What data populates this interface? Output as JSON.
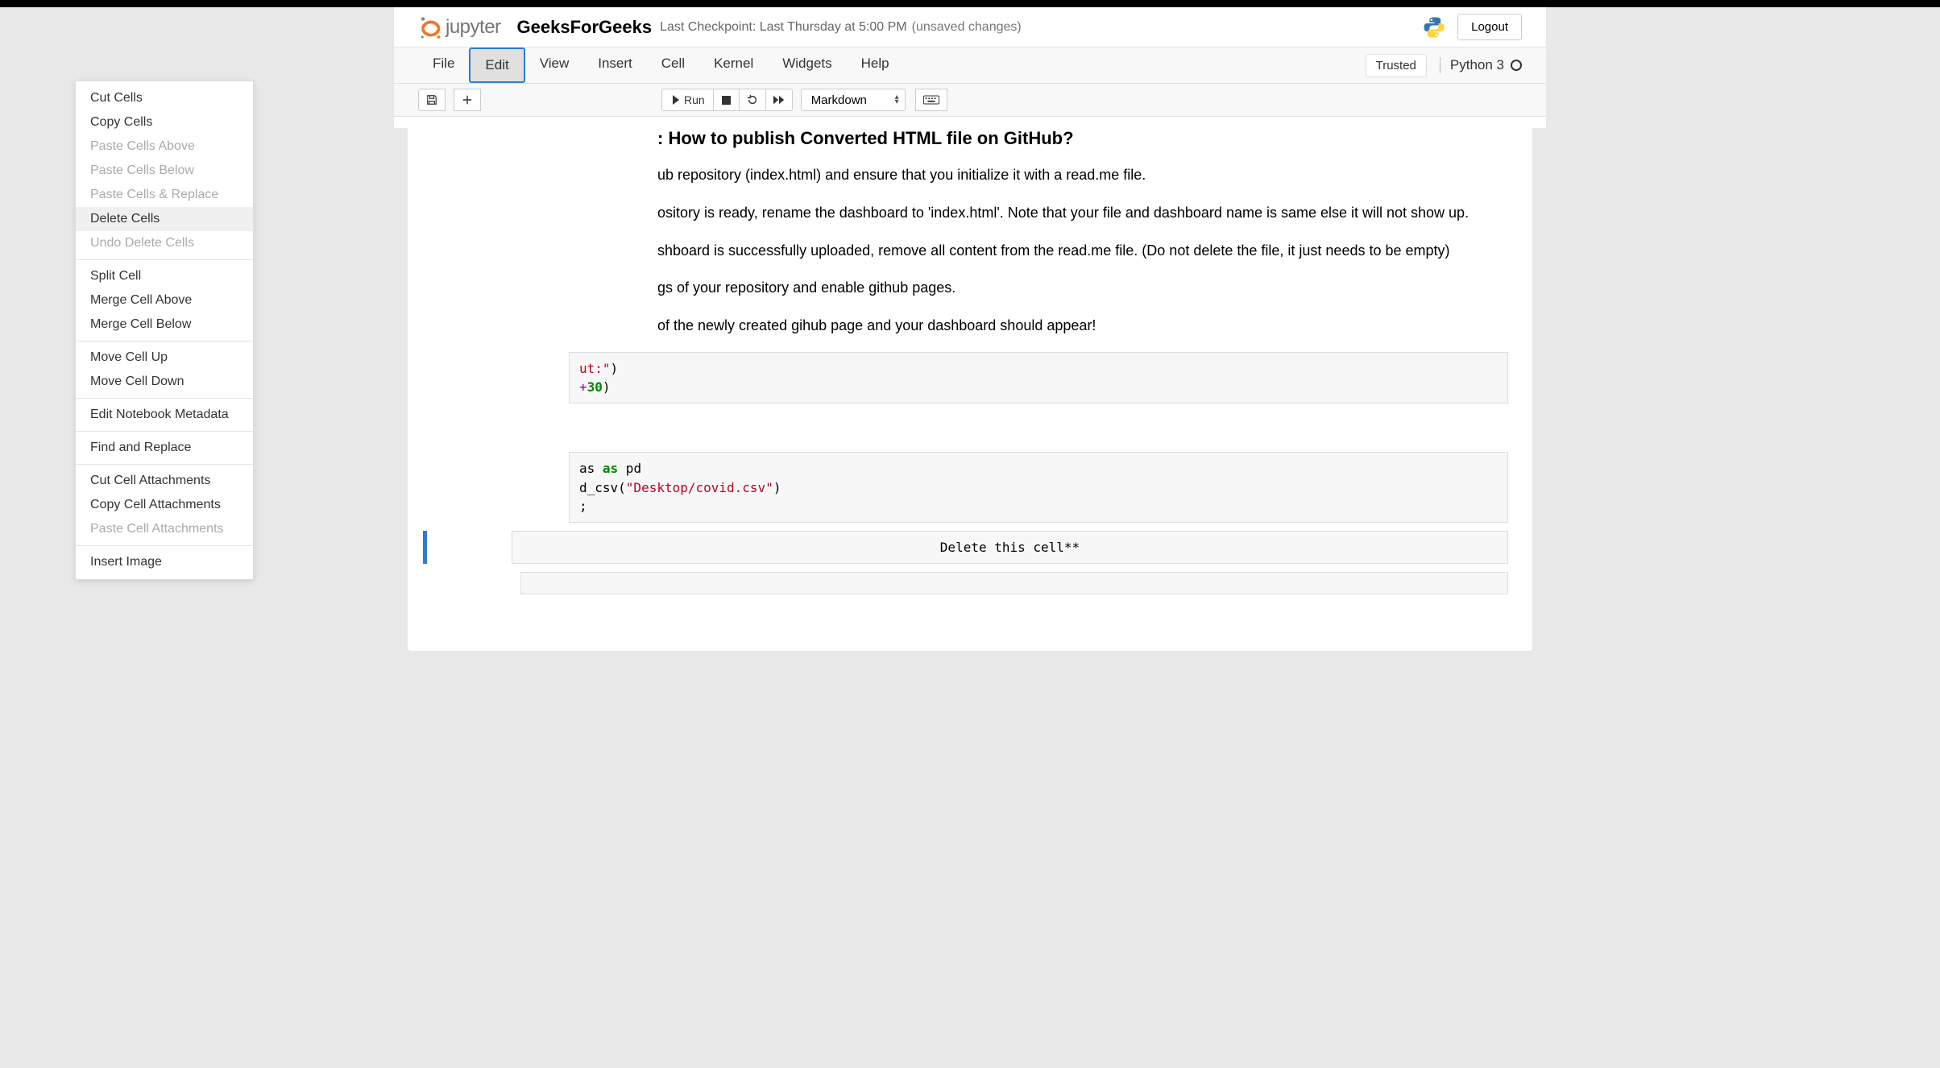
{
  "header": {
    "logo_text": "jupyter",
    "notebook_name": "GeeksForGeeks",
    "checkpoint": "Last Checkpoint: Last Thursday at 5:00 PM",
    "unsaved": "(unsaved changes)",
    "logout": "Logout"
  },
  "menubar": {
    "items": [
      "File",
      "Edit",
      "View",
      "Insert",
      "Cell",
      "Kernel",
      "Widgets",
      "Help"
    ],
    "trusted": "Trusted",
    "kernel": "Python 3"
  },
  "toolbar": {
    "run_label": "Run",
    "cell_type": "Markdown"
  },
  "edit_menu": {
    "items": [
      {
        "label": "Cut Cells",
        "enabled": true
      },
      {
        "label": "Copy Cells",
        "enabled": true
      },
      {
        "label": "Paste Cells Above",
        "enabled": false
      },
      {
        "label": "Paste Cells Below",
        "enabled": false
      },
      {
        "label": "Paste Cells & Replace",
        "enabled": false
      },
      {
        "label": "Delete Cells",
        "enabled": true,
        "highlight": true
      },
      {
        "label": "Undo Delete Cells",
        "enabled": false
      },
      {
        "divider": true
      },
      {
        "label": "Split Cell",
        "enabled": true
      },
      {
        "label": "Merge Cell Above",
        "enabled": true
      },
      {
        "label": "Merge Cell Below",
        "enabled": true
      },
      {
        "divider": true
      },
      {
        "label": "Move Cell Up",
        "enabled": true
      },
      {
        "label": "Move Cell Down",
        "enabled": true
      },
      {
        "divider": true
      },
      {
        "label": "Edit Notebook Metadata",
        "enabled": true
      },
      {
        "divider": true
      },
      {
        "label": "Find and Replace",
        "enabled": true
      },
      {
        "divider": true
      },
      {
        "label": "Cut Cell Attachments",
        "enabled": true
      },
      {
        "label": "Copy Cell Attachments",
        "enabled": true
      },
      {
        "label": "Paste Cell Attachments",
        "enabled": false
      },
      {
        "divider": true
      },
      {
        "label": "Insert Image",
        "enabled": true
      }
    ]
  },
  "content": {
    "heading_fragment": ": How to publish Converted HTML file on GitHub?",
    "line1": "ub repository (index.html) and ensure that you initialize it with a read.me file.",
    "line2": "ository is ready, rename the dashboard to 'index.html'. Note that your file and dashboard name is same else it will not show up.",
    "line3": "shboard is successfully uploaded, remove all content from the read.me file. (Do not delete the file, it just needs to be empty)",
    "line4": "gs of your repository and enable github pages.",
    "line5": "of the newly created gihub page and your dashboard should appear!",
    "code1_l1_a": "ut:\"",
    "code1_l1_b": ")",
    "code1_l2_a": "+",
    "code1_l2_b": "30",
    "code1_l2_c": ")",
    "code2_l1_a": "as ",
    "code2_l1_b": "as",
    "code2_l1_c": " pd",
    "code2_l2_a": "d_csv(",
    "code2_l2_b": "\"Desktop/covid.csv\"",
    "code2_l2_c": ")",
    "code2_l3": ";",
    "md_raw": "Delete this cell**"
  }
}
